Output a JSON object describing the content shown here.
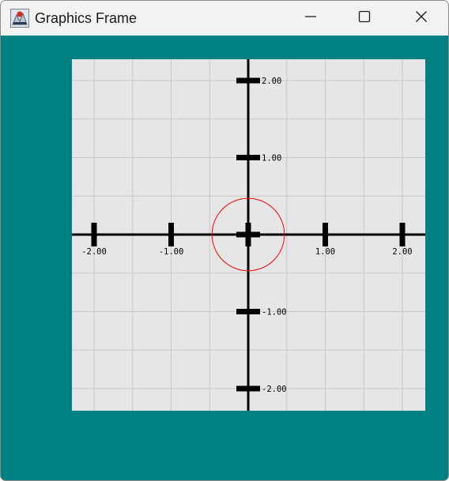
{
  "window": {
    "title": "Graphics Frame",
    "app_icon": "java-app-icon",
    "controls": {
      "minimize": "minimize-icon",
      "maximize": "maximize-icon",
      "close": "close-icon"
    }
  },
  "colors": {
    "content_background": "#008080",
    "plot_background": "#e6e6e6",
    "grid": "#c8c8c8",
    "axis": "#000000",
    "circle": "#ff0000"
  },
  "plot": {
    "x_range": [
      -2.0,
      2.0
    ],
    "y_range": [
      -2.0,
      2.0
    ],
    "grid": true,
    "x_ticks": [
      {
        "value": -2,
        "label": "-2.00"
      },
      {
        "value": -1,
        "label": "-1.00"
      },
      {
        "value": 0,
        "label": ""
      },
      {
        "value": 1,
        "label": "1.00"
      },
      {
        "value": 2,
        "label": "2.00"
      }
    ],
    "y_ticks": [
      {
        "value": 2,
        "label": "2.00"
      },
      {
        "value": 1,
        "label": "1.00"
      },
      {
        "value": 0,
        "label": ""
      },
      {
        "value": -1,
        "label": "-1.00"
      },
      {
        "value": -2,
        "label": "-2.00"
      }
    ],
    "circle": {
      "center_x": 0.0,
      "center_y": 0.0,
      "radius": 0.47
    }
  }
}
